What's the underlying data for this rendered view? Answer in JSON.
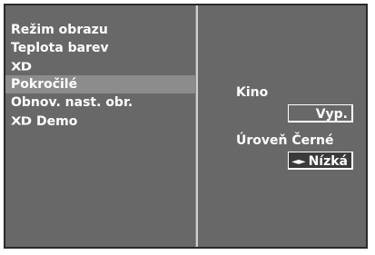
{
  "left_menu": {
    "items": [
      {
        "label": "Režim obrazu"
      },
      {
        "label": "Teplota barev"
      },
      {
        "label": "XD",
        "logo": true
      },
      {
        "label": "Pokročilé",
        "selected": true
      },
      {
        "label": "Obnov. nast. obr."
      },
      {
        "label": "Demo",
        "logo_prefix": "XD"
      }
    ]
  },
  "right_panel": {
    "kino": {
      "label": "Kino",
      "value": "Vyp."
    },
    "black_level": {
      "label": "Úroveň Černé",
      "value": "Nízká",
      "arrows": "◄►"
    }
  },
  "colors": {
    "osd_background": "#686868",
    "selected_row": "#8c8c8c",
    "text": "#ffffff"
  }
}
